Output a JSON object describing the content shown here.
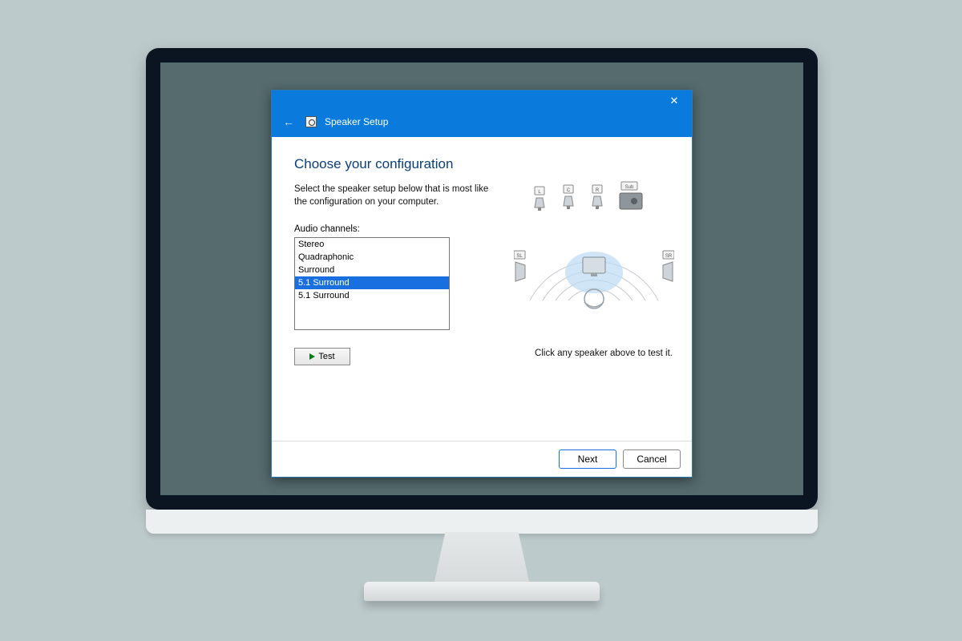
{
  "window": {
    "title": "Speaker Setup",
    "close_label": "✕"
  },
  "page": {
    "heading": "Choose your configuration",
    "instructions": "Select the speaker setup below that is most like the configuration on your computer.",
    "channels_label": "Audio channels:",
    "test_label": "Test",
    "hint": "Click any speaker above to test it."
  },
  "channels": {
    "options": [
      {
        "label": "Stereo",
        "selected": false
      },
      {
        "label": "Quadraphonic",
        "selected": false
      },
      {
        "label": "Surround",
        "selected": false
      },
      {
        "label": "5.1 Surround",
        "selected": true
      },
      {
        "label": "5.1 Surround",
        "selected": false
      }
    ]
  },
  "diagram": {
    "speakers": [
      "L",
      "C",
      "R",
      "Sub",
      "SL",
      "SR"
    ]
  },
  "footer": {
    "next_label": "Next",
    "cancel_label": "Cancel"
  }
}
